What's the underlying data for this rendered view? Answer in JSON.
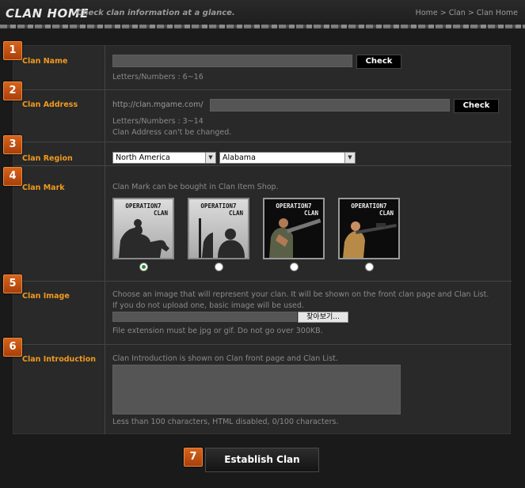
{
  "header": {
    "title": "CLAN HOME",
    "subtitle": "Check clan information at a glance.",
    "breadcrumb": [
      "Home",
      "Clan",
      "Clan Home"
    ],
    "separator": ">"
  },
  "steps": [
    "1",
    "2",
    "3",
    "4",
    "5",
    "6",
    "7"
  ],
  "clan_name": {
    "label": "Clan Name",
    "value": "",
    "check_label": "Check",
    "hint": "Letters/Numbers : 6~16"
  },
  "clan_address": {
    "label": "Clan Address",
    "prefix": "http://clan.mgame.com/",
    "value": "",
    "check_label": "Check",
    "hint1": "Letters/Numbers : 3~14",
    "hint2": "Clan Address can't be changed."
  },
  "clan_region": {
    "label": "Clan Region",
    "country": "North America",
    "state": "Alabama"
  },
  "clan_mark": {
    "label": "Clan Mark",
    "hint": "Clan Mark can be bought in Clan Item Shop.",
    "marks": [
      {
        "line1": "OPERATION7",
        "line2": "CLAN",
        "icon": "silhouette-dog-soldier-icon",
        "selected": true
      },
      {
        "line1": "OPERATION7",
        "line2": "CLAN",
        "icon": "silhouette-rifle-soldier-icon",
        "selected": false
      },
      {
        "line1": "OPERATION7",
        "line2": "CLAN",
        "icon": "soldier-shotgun-icon",
        "selected": false
      },
      {
        "line1": "OPERATION7",
        "line2": "CLAN",
        "icon": "soldier-sniper-icon",
        "selected": false
      }
    ]
  },
  "clan_image": {
    "label": "Clan Image",
    "hint1": "Choose an image that will represent your clan. It will be shown on the front clan page and Clan List.",
    "hint2": "If you do not upload one, basic image will be used.",
    "browse_label": "찾아보기...",
    "hint3": "File extension must be jpg or gif. Do not go over 300KB."
  },
  "clan_intro": {
    "label": "Clan Introduction",
    "hint": "Clan Introduction is shown on Clan front page and Clan List.",
    "value": "",
    "counter": "Less than 100 characters, HTML disabled, 0/100 characters."
  },
  "establish_label": "Establish Clan",
  "colors": {
    "accent": "#f09a1e",
    "step": "#c4521a",
    "panel": "#292929",
    "background": "#1a1a1a"
  }
}
